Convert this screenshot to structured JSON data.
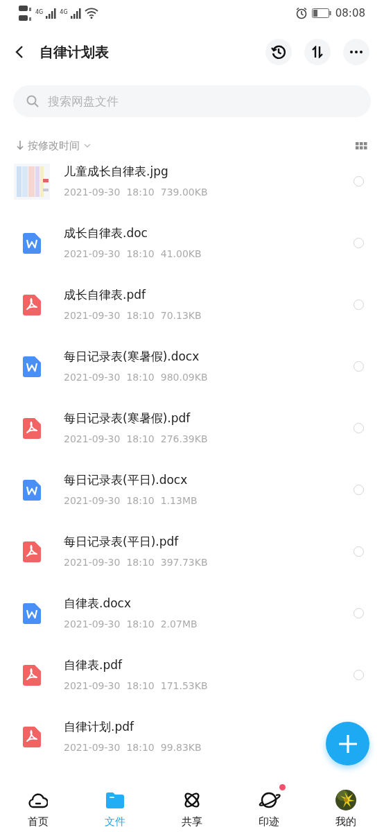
{
  "status_bar": {
    "network_1": "4G",
    "network_2": "4G",
    "time": "08:08"
  },
  "header": {
    "title": "自律计划表"
  },
  "search": {
    "placeholder": "搜索网盘文件"
  },
  "sort": {
    "label": "按修改时间"
  },
  "files": [
    {
      "kind": "picture",
      "name": "儿童成长自律表.jpg",
      "date": "2021-09-30",
      "time": "18:10",
      "size": "739.00KB",
      "selected": false
    },
    {
      "kind": "word",
      "name": "成长自律表.doc",
      "date": "2021-09-30",
      "time": "18:10",
      "size": "41.00KB",
      "selected": false
    },
    {
      "kind": "pdf",
      "name": "成长自律表.pdf",
      "date": "2021-09-30",
      "time": "18:10",
      "size": "70.13KB",
      "selected": false
    },
    {
      "kind": "word",
      "name": "每日记录表(寒暑假).docx",
      "date": "2021-09-30",
      "time": "18:10",
      "size": "980.09KB",
      "selected": false
    },
    {
      "kind": "pdf",
      "name": "每日记录表(寒暑假).pdf",
      "date": "2021-09-30",
      "time": "18:10",
      "size": "276.39KB",
      "selected": false
    },
    {
      "kind": "word",
      "name": "每日记录表(平日).docx",
      "date": "2021-09-30",
      "time": "18:10",
      "size": "1.13MB",
      "selected": false
    },
    {
      "kind": "pdf",
      "name": "每日记录表(平日).pdf",
      "date": "2021-09-30",
      "time": "18:10",
      "size": "397.73KB",
      "selected": false
    },
    {
      "kind": "word",
      "name": "自律表.docx",
      "date": "2021-09-30",
      "time": "18:10",
      "size": "2.07MB",
      "selected": false
    },
    {
      "kind": "pdf",
      "name": "自律表.pdf",
      "date": "2021-09-30",
      "time": "18:10",
      "size": "171.53KB",
      "selected": false
    },
    {
      "kind": "pdf",
      "name": "自律计划.pdf",
      "date": "2021-09-30",
      "time": "18:10",
      "size": "99.83KB"
    }
  ],
  "nav": [
    {
      "kind": "home",
      "label": "首页",
      "selected": false,
      "badge": false
    },
    {
      "kind": "files",
      "label": "文件",
      "selected": true,
      "badge": false
    },
    {
      "kind": "share",
      "label": "共享",
      "selected": false,
      "badge": false
    },
    {
      "kind": "planet",
      "label": "印迹",
      "selected": false,
      "badge": true
    },
    {
      "kind": "avatar",
      "label": "我的",
      "selected": false,
      "badge": false
    }
  ]
}
